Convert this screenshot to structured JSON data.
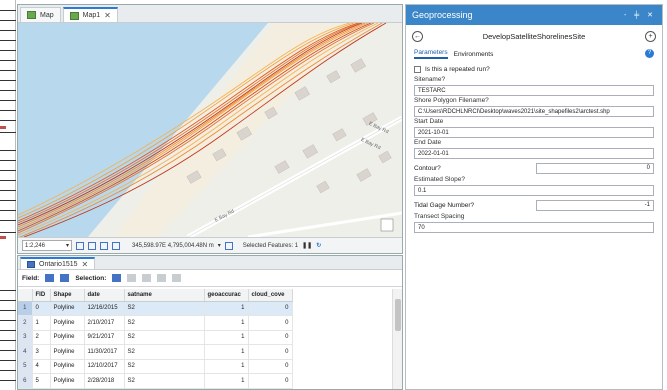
{
  "map_view": {
    "tabs": [
      {
        "label": "Map"
      },
      {
        "label": "Map1"
      }
    ],
    "road_labels": [
      "E Bay Rd",
      "E Bay Rd",
      "E Bay Rd"
    ],
    "status": {
      "scale": "1:2,246",
      "coordinates": "345,598.97E 4,795,004.48N m",
      "selected_features": "Selected Features: 1"
    }
  },
  "attribute_table": {
    "tab_label": "Ontario1515",
    "toolbar": {
      "field_label": "Field:",
      "selection_label": "Selection:"
    },
    "columns": [
      "",
      "FID",
      "Shape",
      "date",
      "satname",
      "geoaccurac",
      "cloud_cove"
    ],
    "rows": [
      {
        "row": "1",
        "fid": "0",
        "shape": "Polyline",
        "date": "12/16/2015",
        "satname": "S2",
        "geoaccurac": "1",
        "cloud": "0"
      },
      {
        "row": "2",
        "fid": "1",
        "shape": "Polyline",
        "date": "2/10/2017",
        "satname": "S2",
        "geoaccurac": "1",
        "cloud": "0"
      },
      {
        "row": "3",
        "fid": "2",
        "shape": "Polyline",
        "date": "9/21/2017",
        "satname": "S2",
        "geoaccurac": "1",
        "cloud": "0"
      },
      {
        "row": "4",
        "fid": "3",
        "shape": "Polyline",
        "date": "11/30/2017",
        "satname": "S2",
        "geoaccurac": "1",
        "cloud": "0"
      },
      {
        "row": "5",
        "fid": "4",
        "shape": "Polyline",
        "date": "12/10/2017",
        "satname": "S2",
        "geoaccurac": "1",
        "cloud": "0"
      },
      {
        "row": "6",
        "fid": "5",
        "shape": "Polyline",
        "date": "2/28/2018",
        "satname": "S2",
        "geoaccurac": "1",
        "cloud": "0"
      }
    ]
  },
  "geoprocessing": {
    "title": "Geoprocessing",
    "header_controls": "- ╪ ✕",
    "tool_name": "DevelopSatelliteShorelinesSite",
    "tabs": {
      "parameters": "Parameters",
      "environments": "Environments"
    },
    "repeated_run_label": "Is this a repeated run?",
    "fields": {
      "sitename_label": "Sitename?",
      "sitename_value": "TESTARC",
      "polygon_label": "Shore Polygon Filename?",
      "polygon_value": "C:\\Users\\RDCHLNRCI\\Desktop\\waves2021\\site_shapefiles2\\arctest.shp",
      "start_label": "Start Date",
      "start_value": "2021-10-01",
      "end_label": "End Date",
      "end_value": "2022-01-01",
      "contour_label": "Contour?",
      "contour_value": "0",
      "slope_label": "Estimated Slope?",
      "slope_value": "0.1",
      "tidal_label": "Tidal Gage Number?",
      "tidal_value": "-1",
      "spacing_label": "Transect Spacing",
      "spacing_value": "70"
    }
  },
  "colors": {
    "accent": "#3b86c9",
    "water": "#b8d8ee",
    "shoreline_dark": "#c0391b",
    "shoreline_light": "#f3a13a"
  }
}
